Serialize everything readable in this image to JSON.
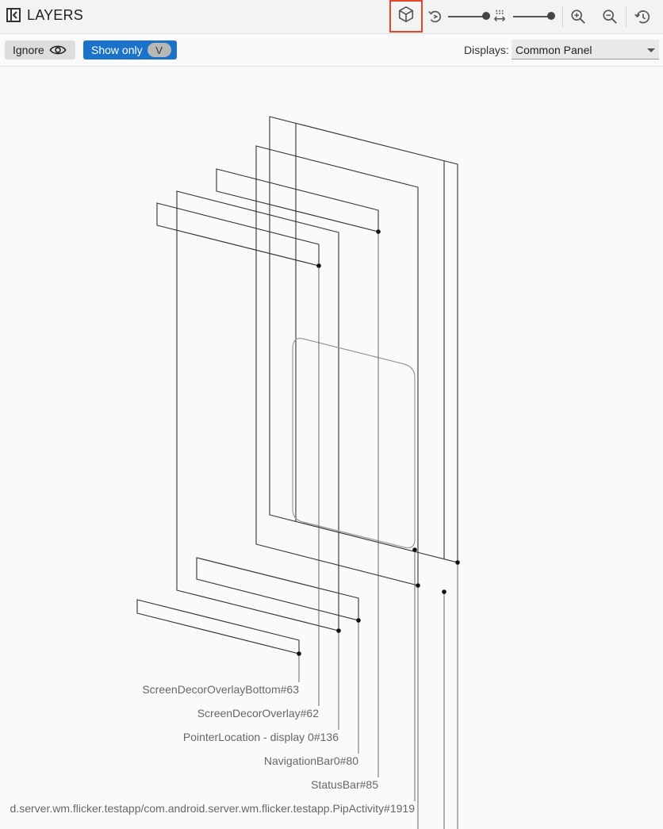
{
  "header": {
    "title": "LAYERS",
    "icons": [
      "panel-collapse-icon",
      "cube-3d-icon",
      "rotate-icon",
      "spacing-icon",
      "zoom-in-icon",
      "zoom-out-icon",
      "reset-history-icon"
    ],
    "rotation_slider_value": 1.0,
    "spacing_slider_value": 1.0
  },
  "options": {
    "ignore_label": "Ignore",
    "show_only_label": "Show only",
    "show_only_shortcut": "V",
    "displays_label": "Displays:",
    "displays_value": "Common Panel"
  },
  "layers": [
    {
      "label": "ScreenDecorOverlayBottom#63"
    },
    {
      "label": "ScreenDecorOverlay#62"
    },
    {
      "label": "PointerLocation - display 0#136"
    },
    {
      "label": "NavigationBar0#80"
    },
    {
      "label": "StatusBar#85"
    },
    {
      "label": "d.server.wm.flicker.testapp/com.android.server.wm.flicker.testapp.PipActivity#1919"
    }
  ],
  "colors": {
    "accent": "#1a73c8",
    "highlight_border": "#e5452b",
    "line": "#333333"
  }
}
